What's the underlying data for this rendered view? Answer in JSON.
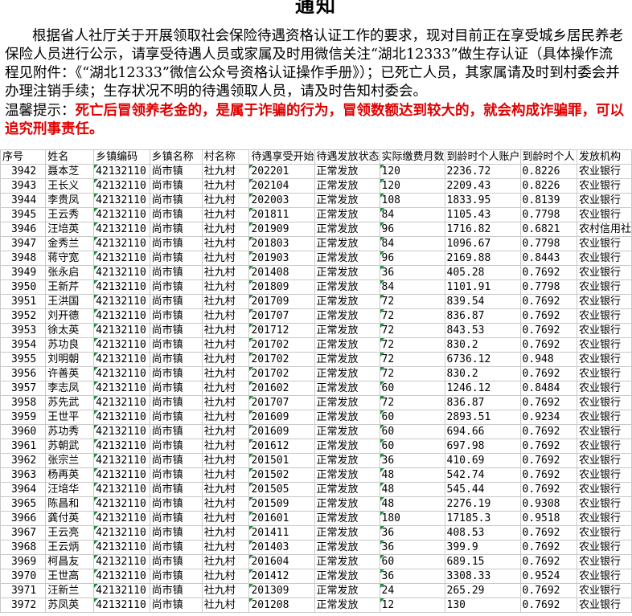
{
  "notice": {
    "title": "通知",
    "paragraph": "根据省人社厅关于开展领取社会保险待遇资格认证工作的要求，现对目前正在享受城乡居民养老保险人员进行公示，请享受待遇人员或家属及时用微信关注“湖北12333”做生存认证（具体操作流程见附件：《“湖北12333”微信公众号资格认证操作手册》）；已死亡人员，其家属请及时到村委会并办理注销手续；生存状况不明的待遇领取人员，请及时告知村委会。",
    "tip_label": "温馨提示：",
    "warning": "死亡后冒领养老金的，是属于诈骗的行为，冒领数额达到较大的，就会构成诈骗罪，可以追究刑事责任。"
  },
  "table": {
    "headers": [
      "序号",
      "姓名",
      "乡镇编码",
      "乡镇名称",
      "村名称",
      "待遇享受开始",
      "待遇发放状态",
      "实际缴费月数",
      "到龄时个人账户",
      "到龄时个人",
      "发放机构"
    ],
    "rows": [
      [
        "3942",
        "聂本芝",
        "42132110",
        "尚市镇",
        "社九村",
        "202201",
        "正常发放",
        "120",
        "2236.72",
        "0.8226",
        "农业银行"
      ],
      [
        "3943",
        "王长义",
        "42132110",
        "尚市镇",
        "社九村",
        "202104",
        "正常发放",
        "120",
        "2209.43",
        "0.8226",
        "农业银行"
      ],
      [
        "3944",
        "李贵凤",
        "42132110",
        "尚市镇",
        "社九村",
        "202003",
        "正常发放",
        "108",
        "1833.95",
        "0.8139",
        "农业银行"
      ],
      [
        "3945",
        "王云秀",
        "42132110",
        "尚市镇",
        "社九村",
        "201811",
        "正常发放",
        "84",
        "1105.43",
        "0.7798",
        "农业银行"
      ],
      [
        "3946",
        "汪培英",
        "42132110",
        "尚市镇",
        "社九村",
        "201909",
        "正常发放",
        "96",
        "1716.82",
        "0.6821",
        "农村信用社"
      ],
      [
        "3947",
        "金秀兰",
        "42132110",
        "尚市镇",
        "社九村",
        "201803",
        "正常发放",
        "84",
        "1096.67",
        "0.7798",
        "农业银行"
      ],
      [
        "3948",
        "蒋守宽",
        "42132110",
        "尚市镇",
        "社九村",
        "201903",
        "正常发放",
        "96",
        "2169.88",
        "0.8443",
        "农业银行"
      ],
      [
        "3949",
        "张永启",
        "42132110",
        "尚市镇",
        "社九村",
        "201408",
        "正常发放",
        "36",
        "405.28",
        "0.7692",
        "农业银行"
      ],
      [
        "3950",
        "王新芹",
        "42132110",
        "尚市镇",
        "社九村",
        "201809",
        "正常发放",
        "84",
        "1101.91",
        "0.7798",
        "农业银行"
      ],
      [
        "3951",
        "王洪国",
        "42132110",
        "尚市镇",
        "社九村",
        "201709",
        "正常发放",
        "72",
        "839.54",
        "0.7692",
        "农业银行"
      ],
      [
        "3952",
        "刘开德",
        "42132110",
        "尚市镇",
        "社九村",
        "201707",
        "正常发放",
        "72",
        "836.87",
        "0.7692",
        "农业银行"
      ],
      [
        "3953",
        "徐太英",
        "42132110",
        "尚市镇",
        "社九村",
        "201712",
        "正常发放",
        "72",
        "843.53",
        "0.7692",
        "农业银行"
      ],
      [
        "3954",
        "苏功良",
        "42132110",
        "尚市镇",
        "社九村",
        "201702",
        "正常发放",
        "72",
        "830.2",
        "0.7692",
        "农业银行"
      ],
      [
        "3955",
        "刘明朝",
        "42132110",
        "尚市镇",
        "社九村",
        "201702",
        "正常发放",
        "72",
        "6736.12",
        "0.948",
        "农业银行"
      ],
      [
        "3956",
        "许善英",
        "42132110",
        "尚市镇",
        "社九村",
        "201702",
        "正常发放",
        "72",
        "830.2",
        "0.7692",
        "农业银行"
      ],
      [
        "3957",
        "李志凤",
        "42132110",
        "尚市镇",
        "社九村",
        "201602",
        "正常发放",
        "60",
        "1246.12",
        "0.8484",
        "农业银行"
      ],
      [
        "3958",
        "苏先武",
        "42132110",
        "尚市镇",
        "社九村",
        "201707",
        "正常发放",
        "72",
        "836.87",
        "0.7692",
        "农业银行"
      ],
      [
        "3959",
        "王世平",
        "42132110",
        "尚市镇",
        "社九村",
        "201609",
        "正常发放",
        "60",
        "2893.51",
        "0.9234",
        "农业银行"
      ],
      [
        "3960",
        "苏功秀",
        "42132110",
        "尚市镇",
        "社九村",
        "201609",
        "正常发放",
        "60",
        "694.66",
        "0.7692",
        "农业银行"
      ],
      [
        "3961",
        "苏朝武",
        "42132110",
        "尚市镇",
        "社九村",
        "201612",
        "正常发放",
        "60",
        "697.98",
        "0.7692",
        "农业银行"
      ],
      [
        "3962",
        "张宗兰",
        "42132110",
        "尚市镇",
        "社九村",
        "201501",
        "正常发放",
        "36",
        "410.69",
        "0.7692",
        "农业银行"
      ],
      [
        "3963",
        "杨再英",
        "42132110",
        "尚市镇",
        "社九村",
        "201502",
        "正常发放",
        "48",
        "542.74",
        "0.7692",
        "农业银行"
      ],
      [
        "3964",
        "汪培华",
        "42132110",
        "尚市镇",
        "社九村",
        "201505",
        "正常发放",
        "48",
        "545.44",
        "0.7692",
        "农业银行"
      ],
      [
        "3965",
        "陈昌和",
        "42132110",
        "尚市镇",
        "社九村",
        "201509",
        "正常发放",
        "48",
        "2276.19",
        "0.9308",
        "农业银行"
      ],
      [
        "3966",
        "龚付英",
        "42132110",
        "尚市镇",
        "社九村",
        "201601",
        "正常发放",
        "180",
        "17185.3",
        "0.9518",
        "农业银行"
      ],
      [
        "3967",
        "王云亮",
        "42132110",
        "尚市镇",
        "社九村",
        "201411",
        "正常发放",
        "36",
        "408.53",
        "0.7692",
        "农业银行"
      ],
      [
        "3968",
        "王云炳",
        "42132110",
        "尚市镇",
        "社九村",
        "201403",
        "正常发放",
        "36",
        "399.9",
        "0.7692",
        "农业银行"
      ],
      [
        "3969",
        "柯昌友",
        "42132110",
        "尚市镇",
        "社九村",
        "201604",
        "正常发放",
        "60",
        "689.15",
        "0.7692",
        "农业银行"
      ],
      [
        "3970",
        "王世高",
        "42132110",
        "尚市镇",
        "社九村",
        "201412",
        "正常发放",
        "36",
        "3308.33",
        "0.9524",
        "农业银行"
      ],
      [
        "3971",
        "汪新兰",
        "42132110",
        "尚市镇",
        "社九村",
        "201309",
        "正常发放",
        "24",
        "265.29",
        "0.7692",
        "农业银行"
      ],
      [
        "3972",
        "苏凤英",
        "42132110",
        "尚市镇",
        "社九村",
        "201208",
        "正常发放",
        "12",
        "130",
        "0.7692",
        "农业银行"
      ]
    ]
  },
  "colors": {
    "warning": "#e00000",
    "grid": "#c8c8c8",
    "code_marker": "#1e8c3a"
  }
}
